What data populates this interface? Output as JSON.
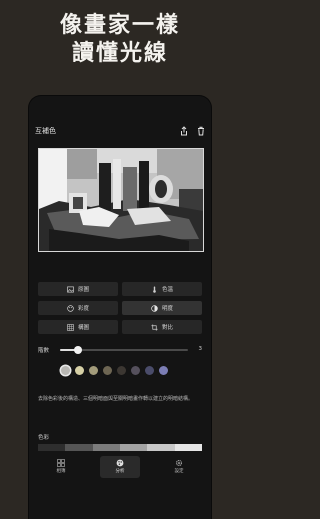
{
  "promo": {
    "line1": "像畫家一樣",
    "line2": "讀懂光線"
  },
  "screen": {
    "title": "互補色"
  },
  "buttons": [
    {
      "label": "原圖",
      "icon": "image-icon"
    },
    {
      "label": "色溫",
      "icon": "thermometer-icon"
    },
    {
      "label": "彩度",
      "icon": "palette-icon"
    },
    {
      "label": "明度",
      "icon": "contrast-icon"
    },
    {
      "label": "構圖",
      "icon": "grid-icon"
    },
    {
      "label": "對比",
      "icon": "crop-icon"
    }
  ],
  "slider": {
    "label": "階數",
    "value": "3",
    "fraction": 0.14
  },
  "swatches": [
    "#b8b7b3",
    "#d6d0a6",
    "#a39c7b",
    "#6e6653",
    "#3c3732",
    "#55505c",
    "#4a4c6a",
    "#7c7eb5"
  ],
  "selected_swatch": 0,
  "description": "去除色彩後的構造、三個明暗面與至關明暗畫作轉以建立的明暗結構。",
  "section_title": "色彩",
  "grey_scale": [
    "#2e2e2e",
    "#555555",
    "#7c7c7c",
    "#a3a3a3",
    "#c8c8c8",
    "#e6e6e6"
  ],
  "tabs": [
    {
      "label": "相簿",
      "icon": "grid-icon",
      "active": false
    },
    {
      "label": "分析",
      "icon": "palette-icon",
      "active": true
    },
    {
      "label": "設定",
      "icon": "gear-icon",
      "active": false
    }
  ]
}
